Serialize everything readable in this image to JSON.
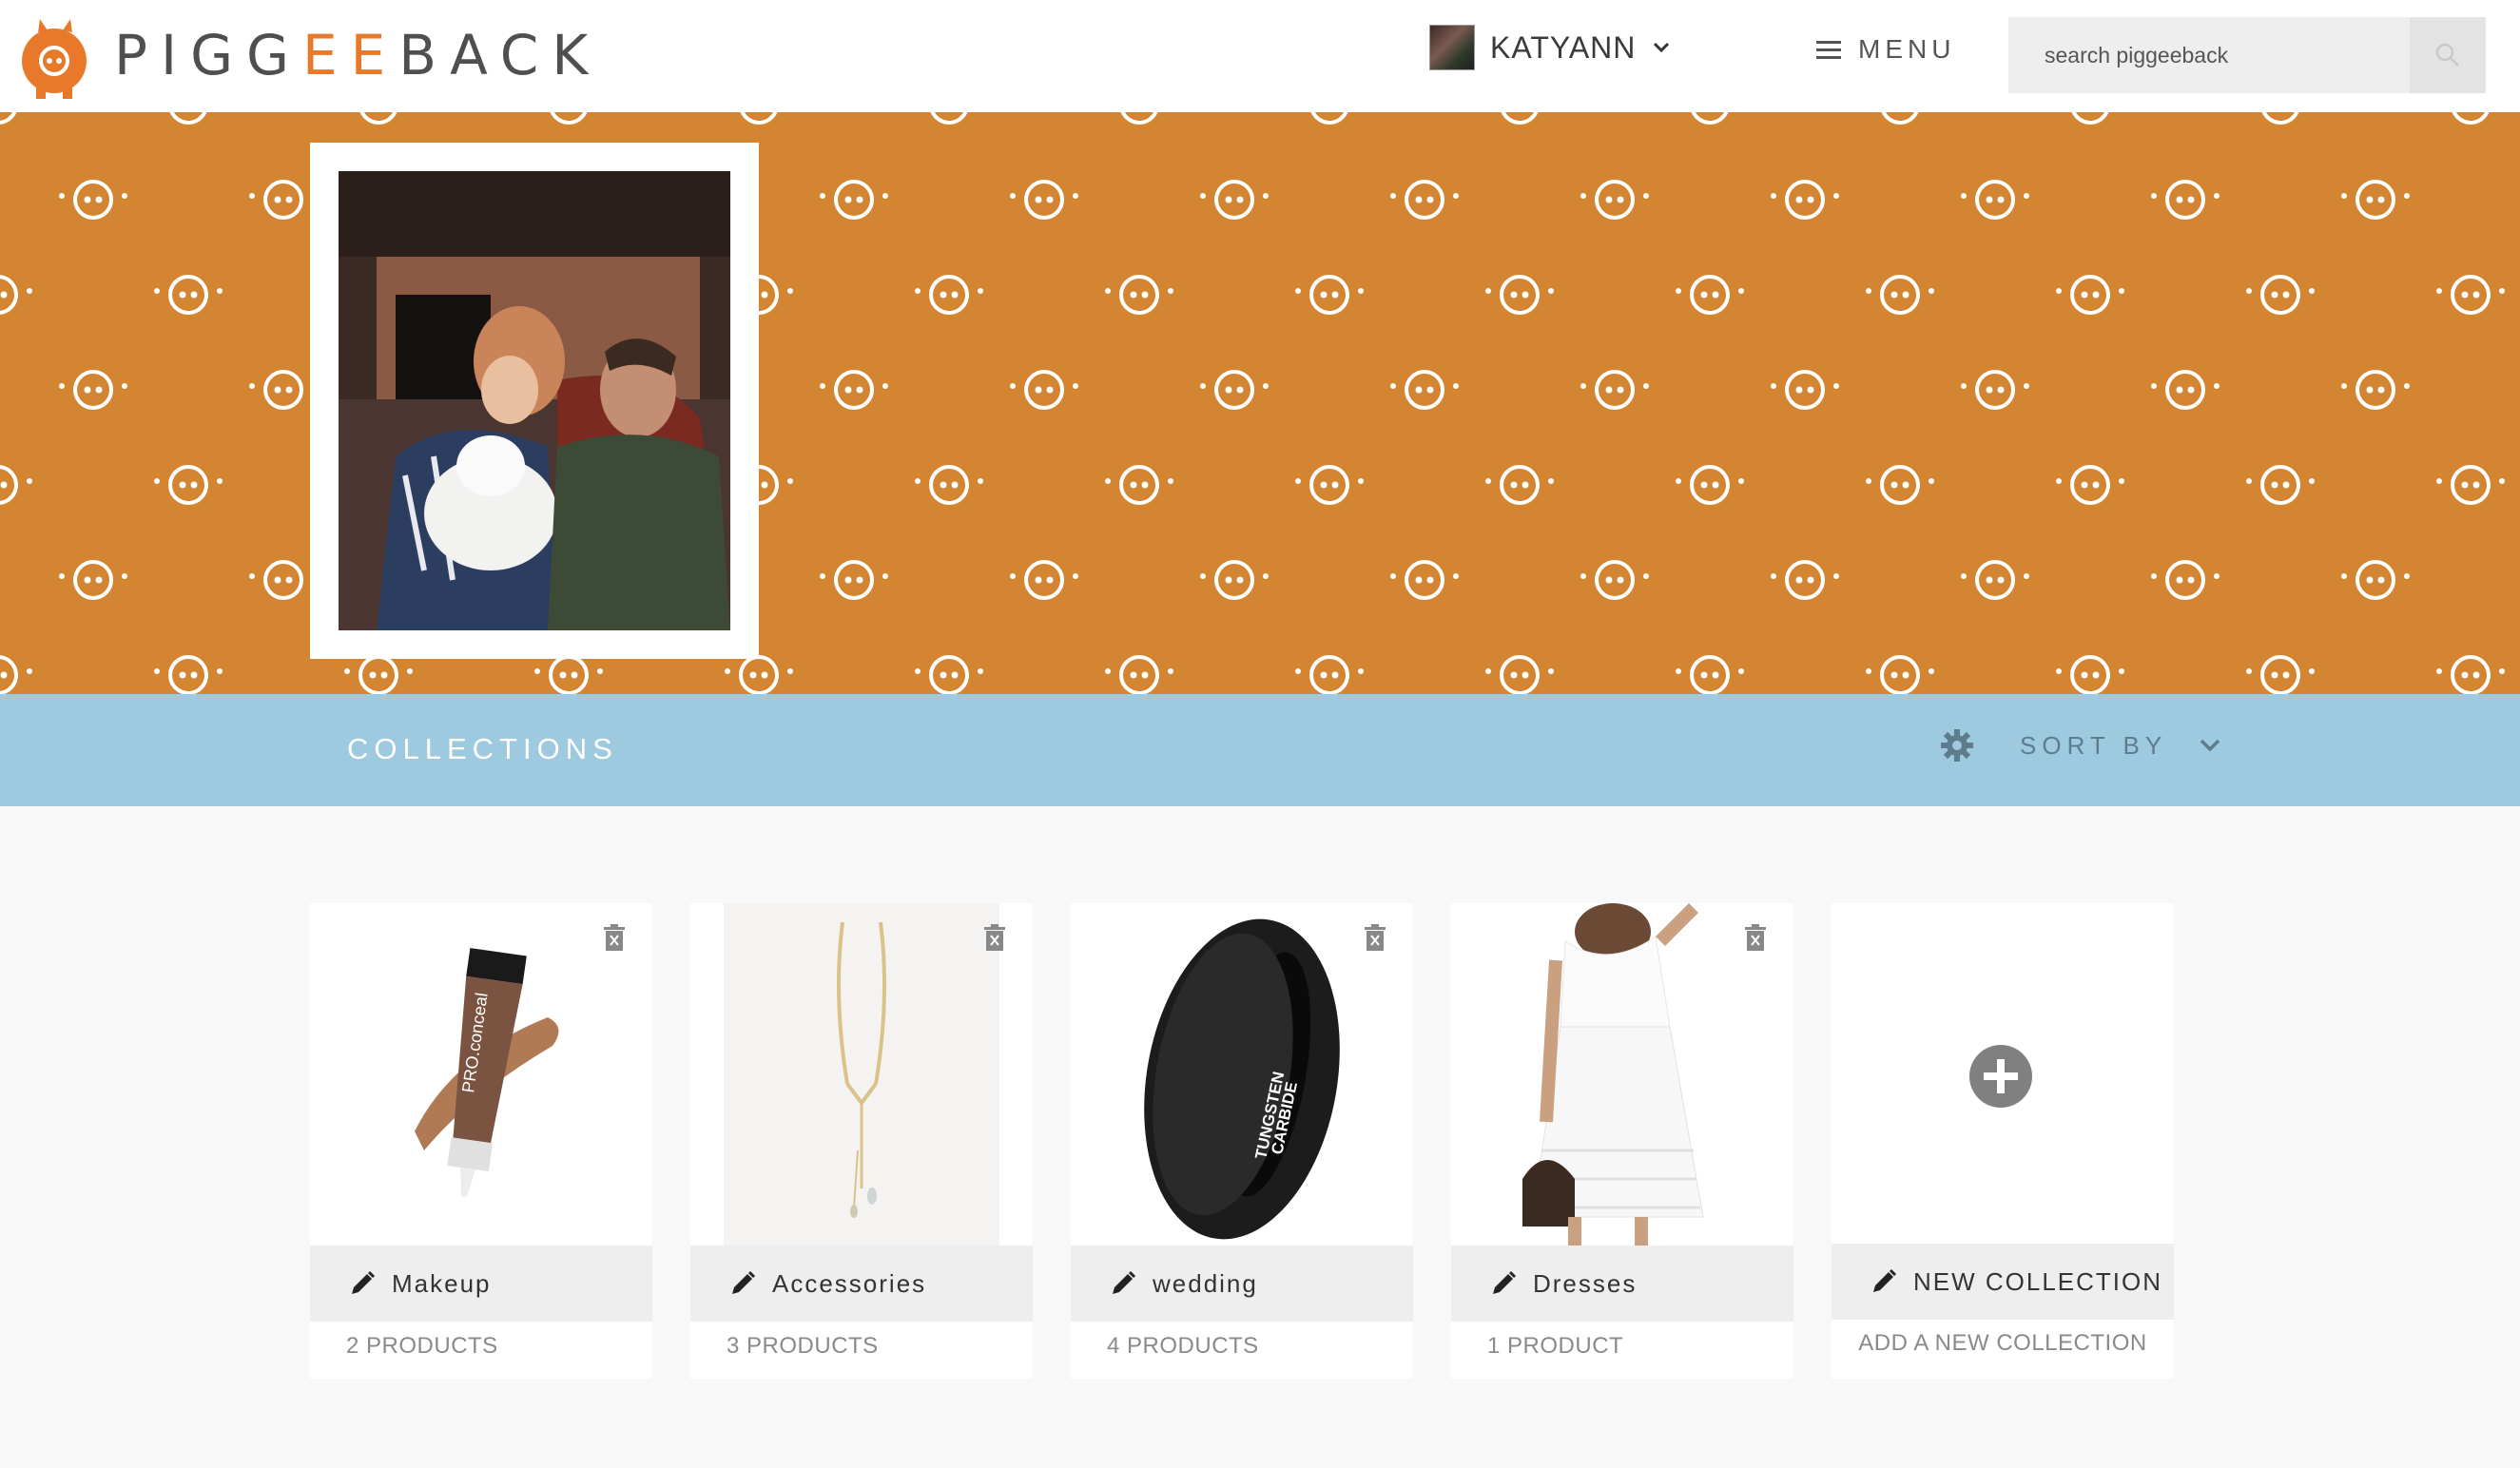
{
  "header": {
    "logo": {
      "part1": "PIGG",
      "part2": "EE",
      "part3": "BACK"
    },
    "user": {
      "name": "KATYANN"
    },
    "menu": {
      "label": "MENU"
    },
    "search": {
      "placeholder": "search piggeeback"
    }
  },
  "collections_bar": {
    "title": "COLLECTIONS",
    "sort_label": "SORT BY"
  },
  "collections": [
    {
      "name": "Makeup",
      "count": "2 PRODUCTS"
    },
    {
      "name": "Accessories",
      "count": "3 PRODUCTS"
    },
    {
      "name": "wedding",
      "count": "4 PRODUCTS"
    },
    {
      "name": "Dresses",
      "count": "1 PRODUCT"
    }
  ],
  "new_collection": {
    "name": "NEW COLLECTION",
    "subtitle": "ADD A NEW COLLECTION"
  },
  "colors": {
    "brand_orange": "#e8792b",
    "banner_orange": "#d48531",
    "collections_blue": "#9dcadf"
  }
}
